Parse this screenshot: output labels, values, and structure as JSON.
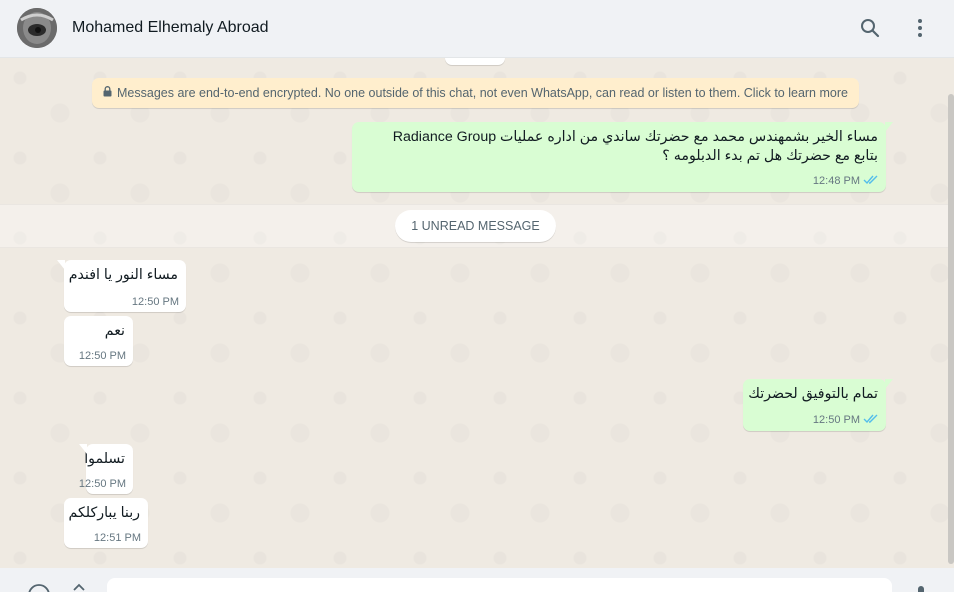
{
  "header": {
    "contact_name": "Mohamed Elhemaly Abroad"
  },
  "encryption_notice": "Messages are end-to-end encrypted. No one outside of this chat, not even WhatsApp, can read or listen to them. Click to learn more",
  "unread_label": "1 UNREAD MESSAGE",
  "messages": [
    {
      "direction": "outgoing",
      "lines": [
        "مساء الخير بشمهندس محمد مع حضرتك ساندي من اداره عمليات Radiance Group",
        "بتابع مع حضرتك هل تم بدء الدبلومه ؟"
      ],
      "time": "12:48 PM",
      "status": "read"
    },
    {
      "direction": "incoming",
      "text": "مساء النور يا افندم",
      "time": "12:50 PM"
    },
    {
      "direction": "incoming",
      "text": "نعم",
      "time": "12:50 PM"
    },
    {
      "direction": "outgoing",
      "text": "تمام بالتوفيق لحضرتك",
      "time": "12:50 PM",
      "status": "read"
    },
    {
      "direction": "incoming",
      "text": "تسلموا",
      "time": "12:50 PM"
    },
    {
      "direction": "incoming",
      "text": "ربنا يباركلكم",
      "time": "12:51 PM"
    }
  ],
  "icons": {
    "search": "search-icon",
    "menu": "kebab-menu-icon",
    "lock": "lock-icon",
    "read_receipt": "double-check-icon",
    "emoji": "emoji-icon",
    "attach": "attach-icon",
    "mic": "mic-icon"
  },
  "colors": {
    "outgoing_bubble": "#d9fdd3",
    "incoming_bubble": "#ffffff",
    "read_tick": "#53bdeb",
    "notice_bg": "#ffeecd"
  }
}
